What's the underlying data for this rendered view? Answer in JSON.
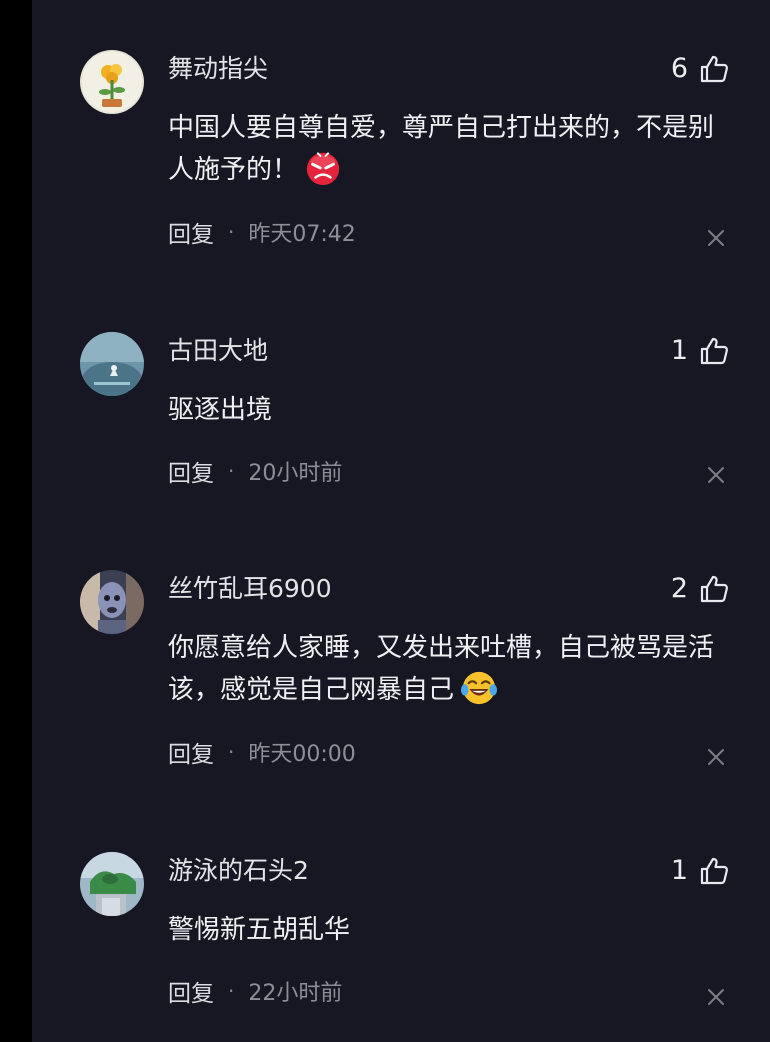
{
  "comments": [
    {
      "username": "舞动指尖",
      "likes": "6",
      "text": "中国人要自尊自爱，尊严自己打出来的，不是别人施予的！",
      "emoji": "angry-face-emoji",
      "reply_label": "回复",
      "separator": "·",
      "time": "昨天07:42"
    },
    {
      "username": "古田大地",
      "likes": "1",
      "text": "驱逐出境",
      "reply_label": "回复",
      "separator": "·",
      "time": "20小时前"
    },
    {
      "username": "丝竹乱耳6900",
      "likes": "2",
      "text": "你愿意给人家睡，又发出来吐槽，自己被骂是活该，感觉是自己网暴自己",
      "emoji": "laughing-crying-emoji",
      "reply_label": "回复",
      "separator": "·",
      "time": "昨天00:00"
    },
    {
      "username": "游泳的石头2",
      "likes": "1",
      "text": "警惕新五胡乱华",
      "reply_label": "回复",
      "separator": "·",
      "time": "22小时前"
    }
  ],
  "icons": {
    "like": "thumbs-up-outline-icon",
    "close": "close-x-icon"
  },
  "colors": {
    "background": "#161722",
    "text": "#f0f0f4",
    "muted": "#8e8e99"
  }
}
